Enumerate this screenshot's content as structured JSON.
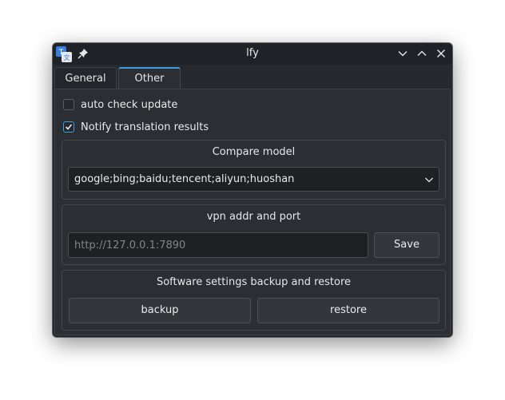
{
  "window": {
    "title": "lfy",
    "app_icon": "translate-icon",
    "controls": [
      "pin-icon",
      "minimize-icon",
      "maximize-icon",
      "close-icon"
    ]
  },
  "tabs": [
    {
      "label": "General",
      "active": false
    },
    {
      "label": "Other",
      "active": true
    }
  ],
  "options": {
    "auto_check_update": {
      "label": "auto check update",
      "checked": false
    },
    "notify_results": {
      "label": "Notify translation results",
      "checked": true
    }
  },
  "compare_model": {
    "title": "Compare model",
    "value": "google;bing;baidu;tencent;aliyun;huoshan"
  },
  "vpn": {
    "title": "vpn addr and port",
    "placeholder": "http://127.0.0.1:7890",
    "value": "",
    "save_label": "Save"
  },
  "backup": {
    "title": "Software settings backup and restore",
    "backup_label": "backup",
    "restore_label": "restore"
  },
  "colors": {
    "accent": "#3d9ee4",
    "window_bg": "#26292d",
    "panel_bg": "#2b2e33"
  }
}
